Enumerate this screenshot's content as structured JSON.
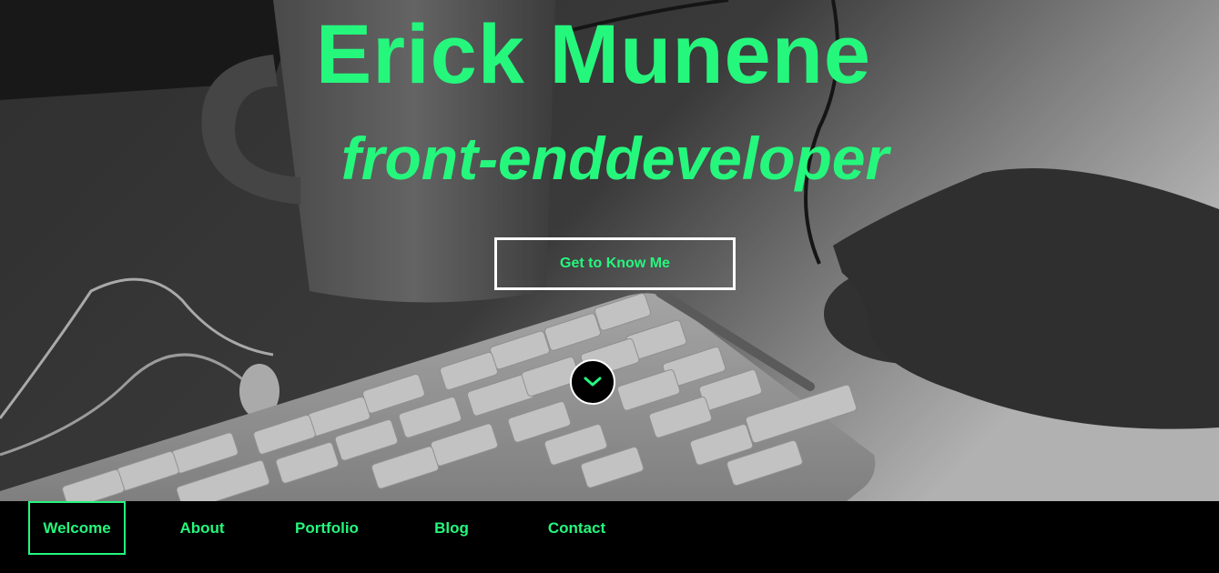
{
  "hero": {
    "title": "Erick Munene",
    "subtitle": "front-enddeveloper",
    "cta_label": "Get to Know Me",
    "scroll_icon": "chevron-down-icon"
  },
  "nav": {
    "items": [
      {
        "label": "Welcome",
        "active": true
      },
      {
        "label": "About",
        "active": false
      },
      {
        "label": "Portfolio",
        "active": false
      },
      {
        "label": "Blog",
        "active": false
      },
      {
        "label": "Contact",
        "active": false
      }
    ]
  },
  "colors": {
    "accent": "#25f77d",
    "nav_background": "#000000",
    "button_border": "#ffffff"
  }
}
